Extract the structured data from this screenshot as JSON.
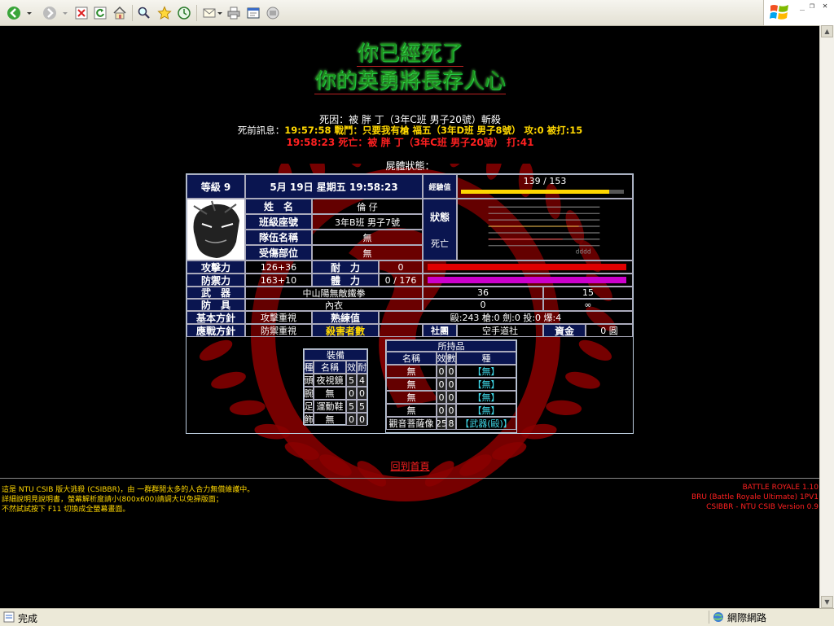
{
  "statusbar": {
    "text": "完成",
    "zone": "網際網路"
  },
  "headline": {
    "line1": "你已經死了",
    "line2": "你的英勇將長存人心"
  },
  "death": {
    "cause": "死因：被 胖 丁（3年C班 男子20號）斬殺",
    "prefix": "死前訊息：",
    "msg_yellow": "19:57:58 戰鬥：只要我有槍 福五（3年D班 男子8號） 攻:0 被打:15",
    "msg_red": "19:58:23 死亡：被 胖 丁（3年C班 男子20號） 打:41",
    "body_state": "屍體狀態："
  },
  "status": {
    "level_label": "等級 9",
    "datetime": "5月 19日 星期五 19:58:23",
    "exp_label": "經驗值",
    "exp_value": "139 / 153",
    "exp_fraction": 0.908,
    "name_label": "姓　名",
    "name_value": "倫 仔",
    "class_label": "班級座號",
    "class_value": "3年B班 男子7號",
    "team_label": "隊伍名稱",
    "team_value": "無",
    "injury_label": "受傷部位",
    "injury_value": "無",
    "state_label": "狀態",
    "state_value": "死亡",
    "atk_label": "攻擊力",
    "atk_value": "126+36",
    "def_label": "防禦力",
    "def_value": "163+10",
    "hp_label": "耐　力",
    "hp_value": "0",
    "sp_label": "體　力",
    "sp_value": "0 / 176",
    "weapon_label": "武　器",
    "weapon_name": "中山陽無敵鐵拳",
    "weapon_atk": "36",
    "weapon_dur": "15",
    "armor_label": "防　具",
    "armor_name": "內衣",
    "armor_def": "0",
    "armor_dur": "∞",
    "policy_label": "基本方針",
    "policy_value": "攻擊重視",
    "skill_label": "熟練值",
    "skill_value": "毆:243 槍:0 劍:0 投:0 爆:4",
    "battle_label": "應戰方針",
    "battle_value": "防禦重視",
    "kills_label": "殺害者數",
    "club_label": "社團",
    "club_value": "空手道社",
    "money_label": "資金",
    "money_value": "0 圓"
  },
  "equip": {
    "title": "裝備",
    "headers": [
      "種",
      "名稱",
      "效",
      "耐"
    ],
    "rows": [
      [
        "頭",
        "夜視鏡",
        "5",
        "4"
      ],
      [
        "腕",
        "無",
        "0",
        "0"
      ],
      [
        "足",
        "運動鞋",
        "5",
        "5"
      ],
      [
        "飾",
        "無",
        "0",
        "0"
      ]
    ]
  },
  "items": {
    "title": "所持品",
    "headers": [
      "名稱",
      "效",
      "數",
      "種"
    ],
    "rows": [
      [
        "無",
        "0",
        "0",
        "【無】"
      ],
      [
        "無",
        "0",
        "0",
        "【無】"
      ],
      [
        "無",
        "0",
        "0",
        "【無】"
      ],
      [
        "無",
        "0",
        "0",
        "【無】"
      ],
      [
        "觀音菩薩像",
        "25",
        "8",
        "【武器(毆)】"
      ]
    ]
  },
  "home_link": "回到首頁",
  "footer": {
    "left1": "這是 NTU CSIB 版大逃殺 (CSIBBR)，由 一群群閒太多的人合力無償維護中。",
    "left2": "詳細說明見說明書，螢幕解析度請小(800x600)請調大以免掃版面；",
    "left3": "不然試試按下 F11 切換成全螢幕畫面。",
    "right1": "BATTLE ROYALE 1.10",
    "right2": "BRU (Battle Royale Ultimate) 1PV1",
    "right3": "CSIBBR - NTU CSIB Version 0.9"
  },
  "colors": {
    "hp_bar": "#e00000",
    "sp_bar": "#cc00cc",
    "exp_bar": "#ffd700",
    "emblem": "#8b0000"
  }
}
